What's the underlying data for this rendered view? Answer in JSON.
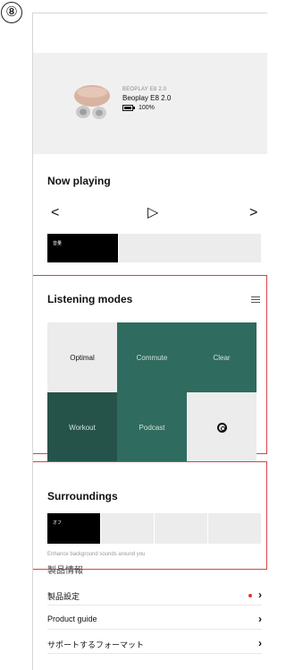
{
  "step_badge": "⑧",
  "device": {
    "brand": "BEOPLAY E8 2.0",
    "name": "Beoplay E8 2.0",
    "battery_percent": 100,
    "battery_text": "100%"
  },
  "now_playing": {
    "title": "Now playing",
    "prev_icon": "chevron-left-icon",
    "play_icon": "play-icon",
    "next_icon": "chevron-right-icon",
    "prev_glyph": "<",
    "play_glyph": "▷",
    "next_glyph": ">",
    "tab_label": "音量"
  },
  "listening_modes": {
    "title": "Listening modes",
    "modes": [
      {
        "label": "Optimal"
      },
      {
        "label": "Commute"
      },
      {
        "label": "Clear"
      },
      {
        "label": "Workout"
      },
      {
        "label": "Podcast"
      },
      {
        "label": ""
      }
    ]
  },
  "surroundings": {
    "title": "Surroundings",
    "active_label": "オフ",
    "caption": "Enhance background sounds around you"
  },
  "product_info": {
    "title": "製品情報",
    "items": [
      {
        "label": "製品設定"
      },
      {
        "label": "Product guide"
      },
      {
        "label": "サポートするフォーマット"
      }
    ],
    "chevron_glyph": "›"
  },
  "colors": {
    "accent_red": "#d7424a",
    "mode_green": "#2f6b5e",
    "mode_green_dark": "#25534a",
    "notification_dot": "#e0392f"
  }
}
